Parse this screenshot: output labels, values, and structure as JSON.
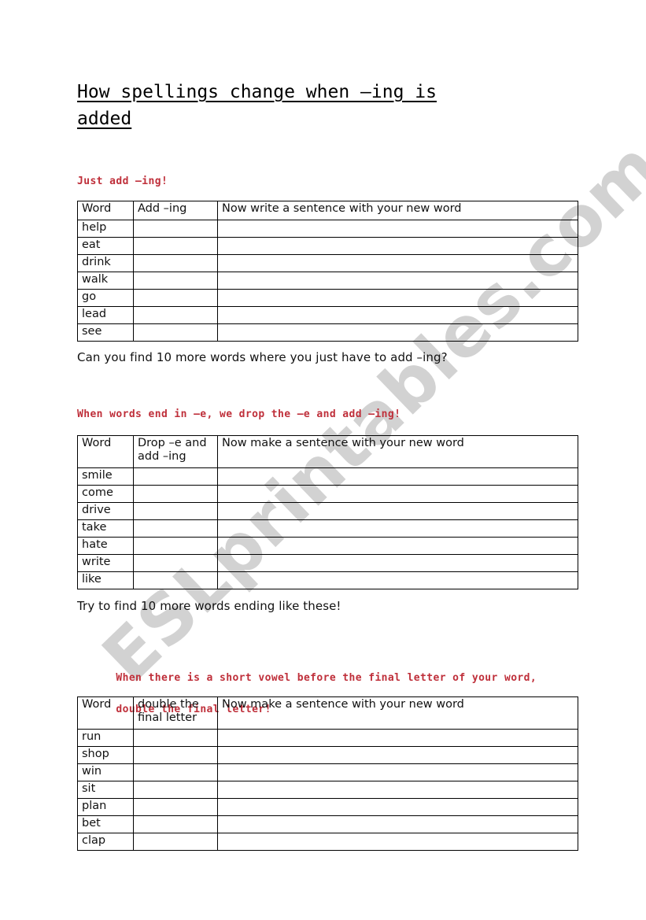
{
  "document": {
    "title_line1": "How spellings change when –ing is",
    "title_line2": "added",
    "watermark": "ESLprintables.com",
    "watermark_color": "#d2d2d2",
    "heading_color": "#bf2f3a"
  },
  "sections": [
    {
      "heading": "Just add –ing!",
      "table": {
        "columns": [
          "Word",
          "Add –ing",
          "Now write a sentence with your new word"
        ],
        "rows": [
          "help",
          "eat",
          "drink",
          "walk",
          "go",
          "lead",
          "see"
        ]
      },
      "followup": "Can you find 10 more words where you just have to add –ing?"
    },
    {
      "heading": "When words end in –e, we drop the –e and add –ing!",
      "table": {
        "columns": [
          "Word",
          "Drop –e and add –ing",
          "Now make a sentence with your new word"
        ],
        "rows": [
          "smile",
          "come",
          "drive",
          "take",
          "hate",
          "write",
          "like"
        ]
      },
      "followup": "Try to find 10 more words ending like these!"
    },
    {
      "heading_line1": "When there is a short vowel before the final letter of your word,",
      "heading_line2": "double the final letter!",
      "table": {
        "columns": [
          "Word",
          "double the final letter",
          "Now make a sentence with your new word"
        ],
        "rows": [
          "run",
          "shop",
          "win",
          "sit",
          "plan",
          "bet",
          "clap"
        ]
      }
    }
  ]
}
